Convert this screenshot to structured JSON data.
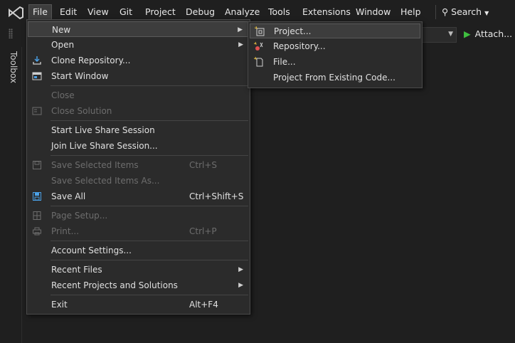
{
  "menubar": {
    "items": [
      "File",
      "Edit",
      "View",
      "Git",
      "Project",
      "Debug",
      "Analyze",
      "Tools",
      "Extensions",
      "Window",
      "Help"
    ],
    "search_label": "Search"
  },
  "toolbar": {
    "attach_label": "Attach..."
  },
  "sidebar": {
    "toolbox_label": "Toolbox"
  },
  "file_menu": {
    "new": "New",
    "open": "Open",
    "clone_repository": "Clone Repository...",
    "start_window": "Start Window",
    "close": "Close",
    "close_solution": "Close Solution",
    "start_live_share": "Start Live Share Session",
    "join_live_share": "Join Live Share Session...",
    "save_selected": "Save Selected Items",
    "save_selected_shortcut": "Ctrl+S",
    "save_selected_as": "Save Selected Items As...",
    "save_all": "Save All",
    "save_all_shortcut": "Ctrl+Shift+S",
    "page_setup": "Page Setup...",
    "print": "Print...",
    "print_shortcut": "Ctrl+P",
    "account_settings": "Account Settings...",
    "recent_files": "Recent Files",
    "recent_projects": "Recent Projects and Solutions",
    "exit": "Exit",
    "exit_shortcut": "Alt+F4"
  },
  "new_submenu": {
    "project": "Project...",
    "repository": "Repository...",
    "file": "File...",
    "project_from_existing": "Project From Existing Code..."
  },
  "colors": {
    "background": "#1f1f1f",
    "menu_bg": "#2b2b2b",
    "highlight": "#3d3d3d",
    "play_green": "#3fbf3f"
  }
}
